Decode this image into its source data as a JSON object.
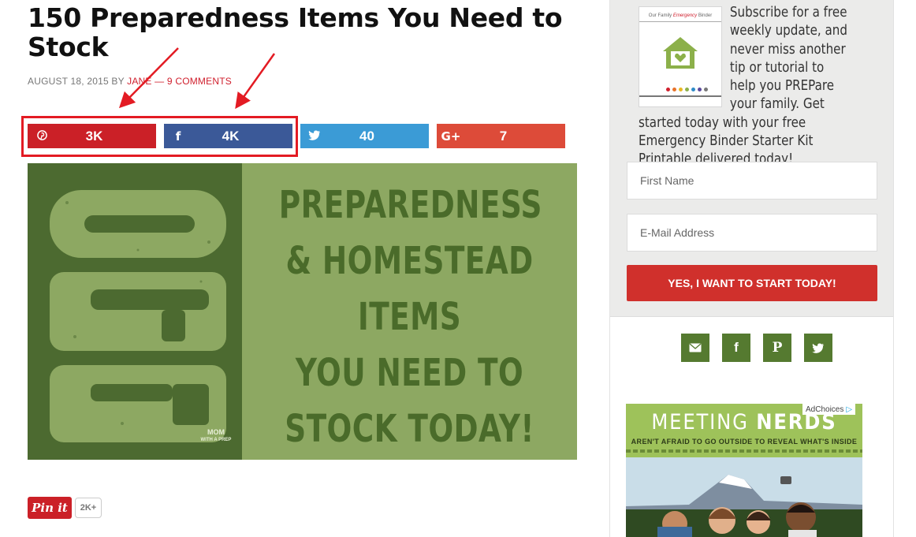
{
  "post": {
    "title": "150 Preparedness Items You Need to Stock",
    "meta": {
      "date": "AUGUST 18, 2015",
      "by": "BY",
      "author": "JANE",
      "sep": "—",
      "comments": "9 COMMENTS"
    }
  },
  "share": {
    "pinterest": {
      "icon": "pinterest-icon",
      "count": "3K",
      "color": "#cb2027"
    },
    "facebook": {
      "icon": "facebook-icon",
      "count": "4K",
      "color": "#3b5998"
    },
    "twitter": {
      "icon": "twitter-icon",
      "count": "40",
      "color": "#3b9bd6"
    },
    "google": {
      "icon": "google-plus-icon",
      "glyph": "G+",
      "count": "7",
      "color": "#dd4b39"
    }
  },
  "hero": {
    "number": "150",
    "lines": [
      "PREPAREDNESS",
      "& HOMESTEAD",
      "ITEMS",
      "YOU NEED TO",
      "STOCK TODAY!"
    ],
    "logo_top": "MOM",
    "logo_bottom": "WITH A PREP"
  },
  "pin": {
    "label": "Pin it",
    "count": "2K+"
  },
  "sidebar": {
    "binder": {
      "title_pre": "Our Family",
      "title_em": "Emergency",
      "title_post": "Binder"
    },
    "optin_text": "Subscribe for a free weekly update, and never miss another tip or tutorial to help you PREPare your family. Get started today with your free Emergency Binder Starter Kit Printable delivered today!",
    "first_name_placeholder": "First Name",
    "email_placeholder": "E-Mail Address",
    "submit_label": "YES, I WANT TO START TODAY!",
    "social": [
      "email-icon",
      "facebook-icon",
      "pinterest-icon",
      "twitter-icon"
    ],
    "accent": "#557a30"
  },
  "ad": {
    "adchoices": "AdChoices",
    "headline_a": "MEETING",
    "headline_b": "NERDS",
    "subline": "AREN'T AFRAID TO GO OUTSIDE TO REVEAL WHAT'S INSIDE"
  }
}
